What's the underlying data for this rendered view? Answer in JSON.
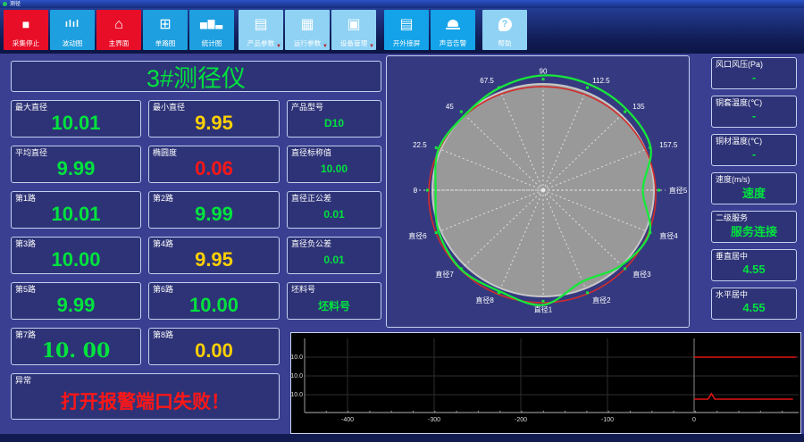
{
  "window": {
    "title": "测径"
  },
  "toolbar": {
    "buttons": [
      {
        "name": "stop-acquisition",
        "label": "采集停止",
        "icon": "stop",
        "style": "red",
        "dropdown": false
      },
      {
        "name": "fluctuation-chart",
        "label": "波动图",
        "icon": "waveform",
        "style": "blue",
        "dropdown": false
      },
      {
        "name": "main-screen",
        "label": "主界面",
        "icon": "home",
        "style": "red",
        "dropdown": false
      },
      {
        "name": "single-channel-chart",
        "label": "单路图",
        "icon": "grid",
        "style": "blue",
        "dropdown": false
      },
      {
        "name": "statistics-chart",
        "label": "统计图",
        "icon": "bar-chart",
        "style": "blue",
        "dropdown": false
      },
      {
        "name": "product-params",
        "label": "产品参数",
        "icon": "list",
        "style": "light",
        "dropdown": true
      },
      {
        "name": "run-params",
        "label": "运行参数",
        "icon": "keypad",
        "style": "light",
        "dropdown": true
      },
      {
        "name": "device-management",
        "label": "设备管理",
        "icon": "device",
        "style": "light",
        "dropdown": true
      },
      {
        "name": "external-screen",
        "label": "开外接屏",
        "icon": "monitor",
        "style": "blue2",
        "dropdown": false
      },
      {
        "name": "sound-alarm",
        "label": "声音告警",
        "icon": "siren",
        "style": "blue2",
        "dropdown": false
      },
      {
        "name": "help",
        "label": "帮助",
        "icon": "question",
        "style": "light",
        "dropdown": false
      }
    ]
  },
  "gauge_title": "3#测径仪",
  "measurements": [
    {
      "name": "max-diameter",
      "label": "最大直径",
      "value": "10.01",
      "color": "green"
    },
    {
      "name": "min-diameter",
      "label": "最小直径",
      "value": "9.95",
      "color": "yellow"
    },
    {
      "name": "product-model",
      "label": "产品型号",
      "value": "D10",
      "color": "green",
      "small": true
    },
    {
      "name": "avg-diameter",
      "label": "平均直径",
      "value": "9.99",
      "color": "green"
    },
    {
      "name": "ovality",
      "label": "椭圆度",
      "value": "0.06",
      "color": "red"
    },
    {
      "name": "nominal-diameter",
      "label": "直径标称值",
      "value": "10.00",
      "color": "green",
      "small": true
    },
    {
      "name": "channel-1",
      "label": "第1路",
      "value": "10.01",
      "color": "green"
    },
    {
      "name": "channel-2",
      "label": "第2路",
      "value": "9.99",
      "color": "green"
    },
    {
      "name": "plus-tolerance",
      "label": "直径正公差",
      "value": "0.01",
      "color": "green",
      "small": true
    },
    {
      "name": "channel-3",
      "label": "第3路",
      "value": "10.00",
      "color": "green"
    },
    {
      "name": "channel-4",
      "label": "第4路",
      "value": "9.95",
      "color": "yellow"
    },
    {
      "name": "minus-tolerance",
      "label": "直径负公差",
      "value": "0.01",
      "color": "green",
      "small": true
    },
    {
      "name": "channel-5",
      "label": "第5路",
      "value": "9.99",
      "color": "green"
    },
    {
      "name": "channel-6",
      "label": "第6路",
      "value": "10.00",
      "color": "green"
    },
    {
      "name": "billet-no",
      "label": "坯料号",
      "value": "坯料号",
      "color": "green",
      "small": true
    },
    {
      "name": "channel-7",
      "label": "第7路",
      "value": "10. 00",
      "color": "green",
      "serif": true
    },
    {
      "name": "channel-8",
      "label": "第8路",
      "value": "0.00",
      "color": "yellow"
    },
    {
      "name": "exception",
      "label": "异常",
      "value": "打开报警端口失败！",
      "color": "red",
      "wide": true
    }
  ],
  "right_panel": [
    {
      "name": "air-pressure",
      "label": "风口风压(Pa)",
      "value": "-"
    },
    {
      "name": "sleeve-temp",
      "label": "铜套温度(℃)",
      "value": "-"
    },
    {
      "name": "material-temp",
      "label": "铜材温度(℃)",
      "value": "-"
    },
    {
      "name": "speed",
      "label": "速度(m/s)",
      "value": "速度"
    },
    {
      "name": "secondary-service",
      "label": "二级服务",
      "value": "服务连接"
    },
    {
      "name": "vertical-center",
      "label": "垂直居中",
      "value": "4.55"
    },
    {
      "name": "horizontal-center",
      "label": "水平居中",
      "value": "4.55"
    }
  ],
  "chart_data": [
    {
      "type": "polar-profile",
      "description": "cross-section roundness profile: gray nominal disc, red tolerance circle, green measured profile",
      "colors": {
        "nominal_disc": "#999999",
        "disc_rim": "#c7c7c7",
        "tolerance_circle": "#d32b2b",
        "profile": "#17e83a",
        "spokes": "#eeeeee"
      },
      "angle_step_deg": 22.5,
      "spoke_labels": [
        {
          "angle_deg": 180,
          "label": "0"
        },
        {
          "angle_deg": 157.5,
          "label": "22.5"
        },
        {
          "angle_deg": 135,
          "label": "45"
        },
        {
          "angle_deg": 112.5,
          "label": "67.5"
        },
        {
          "angle_deg": 90,
          "label": "90"
        },
        {
          "angle_deg": 67.5,
          "label": "112.5"
        },
        {
          "angle_deg": 45,
          "label": "135"
        },
        {
          "angle_deg": 22.5,
          "label": "157.5"
        },
        {
          "angle_deg": 0,
          "label": "直径5"
        },
        {
          "angle_deg": -22.5,
          "label": "直径4"
        },
        {
          "angle_deg": -45,
          "label": "直径3"
        },
        {
          "angle_deg": -67.5,
          "label": "直径2"
        },
        {
          "angle_deg": -90,
          "label": "直径1"
        },
        {
          "angle_deg": -112.5,
          "label": "直径8"
        },
        {
          "angle_deg": -135,
          "label": "直径7"
        },
        {
          "angle_deg": -157.5,
          "label": "直径6"
        }
      ],
      "profile_angles_deg": [
        0,
        22.5,
        45,
        67.5,
        90,
        112.5,
        135,
        157.5,
        180,
        202.5,
        225,
        247.5,
        270,
        292.5,
        315,
        337.5
      ],
      "profile_scale_vs_nominal": [
        0.9,
        1.05,
        1.07,
        1.08,
        1.08,
        1.04,
        1.0,
        1.02,
        0.97,
        1.02,
        1.05,
        1.03,
        1.08,
        0.93,
        1.0,
        1.04
      ],
      "tolerance_scale_vs_nominal": 1.025
    },
    {
      "type": "line",
      "description": "diameter trend strip chart, black background, current values in red right of x=0",
      "x_ticks": [
        -400,
        -300,
        -200,
        -100,
        0
      ],
      "x_range": [
        -449,
        118
      ],
      "y_gridline_labels": [
        "10.0",
        "10.0",
        "10.0"
      ],
      "divider_x": 0,
      "series": [
        {
          "name": "upper-trace",
          "color": "#e01414",
          "points": [
            [
              0,
              1
            ],
            [
              118,
              1
            ]
          ]
        },
        {
          "name": "lower-trace",
          "color": "#e01414",
          "points": [
            [
              0,
              3.24
            ],
            [
              16,
              3.24
            ],
            [
              20,
              2.95
            ],
            [
              24,
              3.24
            ],
            [
              114,
              3.24
            ]
          ]
        }
      ]
    }
  ]
}
